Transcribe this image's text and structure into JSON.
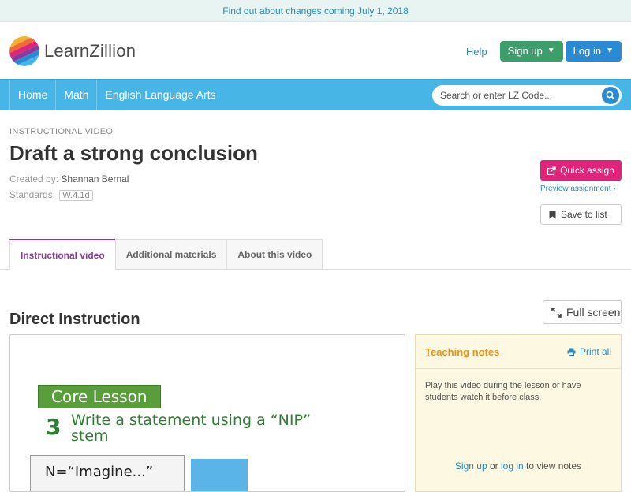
{
  "banner": {
    "text": "Find out about changes coming July 1, 2018"
  },
  "header": {
    "logo_text": "LearnZillion",
    "help_label": "Help",
    "signup_label": "Sign up",
    "login_label": "Log in"
  },
  "nav": {
    "items": [
      {
        "label": "Home"
      },
      {
        "label": "Math"
      },
      {
        "label": "English Language Arts"
      }
    ],
    "search_placeholder": "Search or enter LZ Code..."
  },
  "page": {
    "eyebrow": "INSTRUCTIONAL VIDEO",
    "title": "Draft a strong conclusion",
    "created_label": "Created by:",
    "created_by": "Shannan Bernal",
    "standards_label": "Standards:",
    "standard": "W.4.1d"
  },
  "actions": {
    "quick_assign": "Quick assign",
    "preview": "Preview assignment ›",
    "save": "Save to list",
    "fullscreen": "Full screen"
  },
  "tabs": [
    {
      "label": "Instructional video",
      "active": true
    },
    {
      "label": "Additional materials",
      "active": false
    },
    {
      "label": "About this video",
      "active": false
    }
  ],
  "section": {
    "title": "Direct Instruction"
  },
  "video": {
    "core_label": "Core Lesson",
    "step_number": "3",
    "step_text_1": "Write a statement using a “NIP”",
    "step_text_2": "stem",
    "card_text": "N=“Imagine...”"
  },
  "notes": {
    "title": "Teaching notes",
    "print_label": "Print all",
    "body": "Play this video during the lesson or have students watch it before class.",
    "signup_link": "Sign up",
    "or_text": "or",
    "login_link": "log in",
    "tail_text": "to view notes"
  },
  "colors": {
    "banner_bg": "#e7f4f1",
    "nav_bg": "#47b6e6",
    "signup": "#3b9e6b",
    "login": "#2a8ad4",
    "quick_assign": "#e0247a",
    "active_tab": "#8b3a99",
    "notes_title": "#e8941a"
  }
}
